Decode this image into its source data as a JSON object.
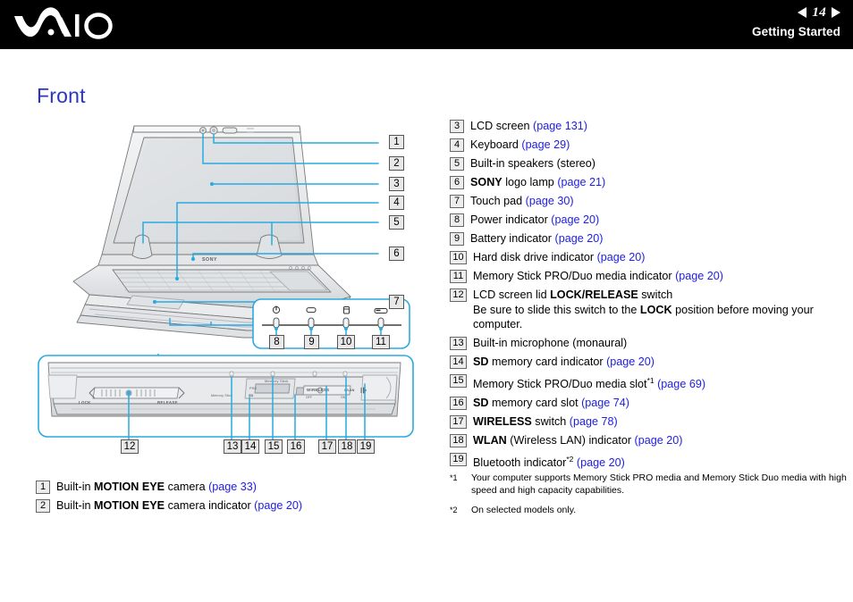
{
  "header": {
    "logo": "VAIO",
    "page_number": "14",
    "section": "Getting Started",
    "prev_icon": "triangle-left-icon",
    "next_icon": "triangle-right-icon"
  },
  "page": {
    "heading": "Front"
  },
  "legend_left": [
    {
      "num": "1",
      "parts": [
        {
          "t": "Built-in ",
          "s": "plain"
        },
        {
          "t": "MOTION EYE",
          "s": "bold"
        },
        {
          "t": " camera ",
          "s": "plain"
        },
        {
          "t": "(page 33)",
          "s": "link"
        }
      ]
    },
    {
      "num": "2",
      "parts": [
        {
          "t": "Built-in ",
          "s": "plain"
        },
        {
          "t": "MOTION EYE",
          "s": "bold"
        },
        {
          "t": " camera indicator ",
          "s": "plain"
        },
        {
          "t": "(page 20)",
          "s": "link"
        }
      ]
    }
  ],
  "legend_right": [
    {
      "num": "3",
      "parts": [
        {
          "t": "LCD screen ",
          "s": "plain"
        },
        {
          "t": "(page 131)",
          "s": "link"
        }
      ]
    },
    {
      "num": "4",
      "parts": [
        {
          "t": "Keyboard ",
          "s": "plain"
        },
        {
          "t": "(page 29)",
          "s": "link"
        }
      ]
    },
    {
      "num": "5",
      "parts": [
        {
          "t": "Built-in speakers (stereo)",
          "s": "plain"
        }
      ]
    },
    {
      "num": "6",
      "parts": [
        {
          "t": "SONY",
          "s": "bold"
        },
        {
          "t": " logo lamp ",
          "s": "plain"
        },
        {
          "t": "(page 21)",
          "s": "link"
        }
      ]
    },
    {
      "num": "7",
      "parts": [
        {
          "t": "Touch pad ",
          "s": "plain"
        },
        {
          "t": "(page 30)",
          "s": "link"
        }
      ]
    },
    {
      "num": "8",
      "parts": [
        {
          "t": "Power indicator ",
          "s": "plain"
        },
        {
          "t": "(page 20)",
          "s": "link"
        }
      ]
    },
    {
      "num": "9",
      "parts": [
        {
          "t": "Battery indicator ",
          "s": "plain"
        },
        {
          "t": "(page 20)",
          "s": "link"
        }
      ]
    },
    {
      "num": "10",
      "parts": [
        {
          "t": "Hard disk drive indicator ",
          "s": "plain"
        },
        {
          "t": "(page 20)",
          "s": "link"
        }
      ]
    },
    {
      "num": "11",
      "parts": [
        {
          "t": "Memory Stick PRO/Duo media indicator ",
          "s": "plain"
        },
        {
          "t": "(page 20)",
          "s": "link"
        }
      ]
    },
    {
      "num": "12",
      "parts": [
        {
          "t": "LCD screen lid ",
          "s": "plain"
        },
        {
          "t": "LOCK/RELEASE",
          "s": "bold"
        },
        {
          "t": " switch",
          "s": "plain"
        },
        {
          "t": "\n",
          "s": "break"
        },
        {
          "t": "Be sure to slide this switch to the ",
          "s": "plain"
        },
        {
          "t": "LOCK",
          "s": "bold"
        },
        {
          "t": " position before moving your computer.",
          "s": "plain"
        }
      ]
    },
    {
      "num": "13",
      "parts": [
        {
          "t": "Built-in microphone (monaural)",
          "s": "plain"
        }
      ]
    },
    {
      "num": "14",
      "parts": [
        {
          "t": "SD",
          "s": "bold"
        },
        {
          "t": " memory card indicator ",
          "s": "plain"
        },
        {
          "t": "(page 20)",
          "s": "link"
        }
      ]
    },
    {
      "num": "15",
      "parts": [
        {
          "t": "Memory Stick PRO/Duo media slot",
          "s": "plain"
        },
        {
          "t": "*1",
          "s": "sup"
        },
        {
          "t": " ",
          "s": "plain"
        },
        {
          "t": "(page 69)",
          "s": "link"
        }
      ]
    },
    {
      "num": "16",
      "parts": [
        {
          "t": "SD",
          "s": "bold"
        },
        {
          "t": " memory card slot ",
          "s": "plain"
        },
        {
          "t": "(page 74)",
          "s": "link"
        }
      ]
    },
    {
      "num": "17",
      "parts": [
        {
          "t": "WIRELESS",
          "s": "bold"
        },
        {
          "t": " switch ",
          "s": "plain"
        },
        {
          "t": "(page 78)",
          "s": "link"
        }
      ]
    },
    {
      "num": "18",
      "parts": [
        {
          "t": "WLAN",
          "s": "bold"
        },
        {
          "t": " (Wireless LAN) indicator ",
          "s": "plain"
        },
        {
          "t": "(page 20)",
          "s": "link"
        }
      ]
    },
    {
      "num": "19",
      "parts": [
        {
          "t": "Bluetooth indicator",
          "s": "plain"
        },
        {
          "t": "*2",
          "s": "sup"
        },
        {
          "t": " ",
          "s": "plain"
        },
        {
          "t": "(page 20)",
          "s": "link"
        }
      ]
    }
  ],
  "footnotes": [
    {
      "mark": "*1",
      "text": "Your computer supports Memory Stick PRO media and Memory Stick Duo media with high speed and high capacity capabilities."
    },
    {
      "mark": "*2",
      "text": "On selected models only."
    }
  ],
  "figure_top": {
    "name": "laptop-open-front-view",
    "callouts": [
      "1",
      "2",
      "3",
      "4",
      "5",
      "6",
      "7"
    ],
    "indicator_panel_callouts": [
      "8",
      "9",
      "10",
      "11"
    ],
    "indicator_icons": [
      "power-icon",
      "battery-icon",
      "hard-disk-icon",
      "memory-stick-icon"
    ],
    "sony_logo_label": "SONY"
  },
  "figure_bottom": {
    "name": "laptop-front-edge-view",
    "callouts": [
      "12",
      "13",
      "14",
      "15",
      "16",
      "17",
      "18",
      "19"
    ],
    "labels": {
      "lock": "LOCK",
      "release": "RELEASE",
      "memory_stick": "Memory Stick",
      "memory_stick_small": "Memory Stick",
      "pro": "PRO",
      "sd": "SD",
      "wireless": "WIRELESS",
      "off": "OFF",
      "on": "ON",
      "wlan": "WLAN"
    }
  },
  "colors": {
    "heading": "#2b35c4",
    "link": "#2020e0",
    "callout_line": "#29abe2",
    "header_bg": "#000000",
    "illustration_stroke": "#6d6d6d"
  }
}
